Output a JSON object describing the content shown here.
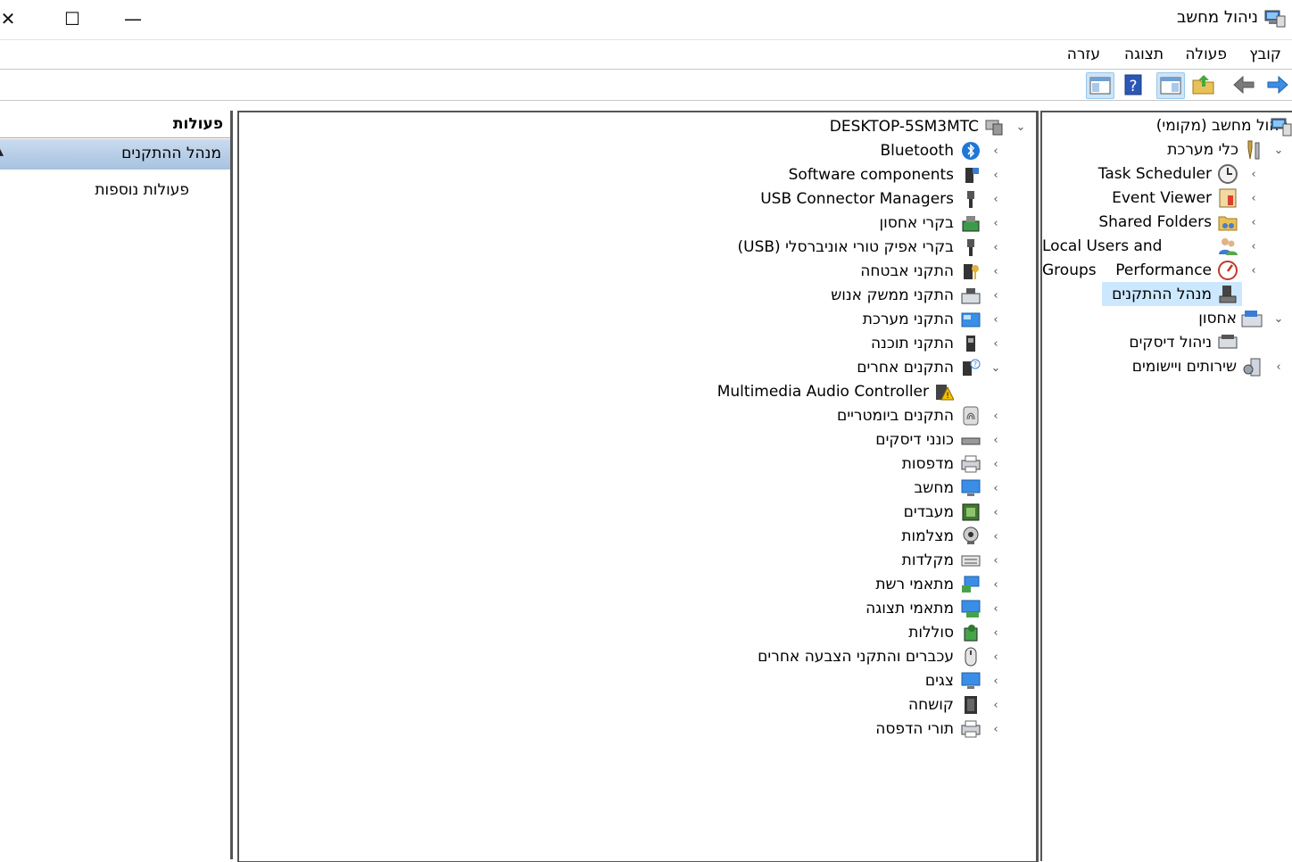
{
  "window": {
    "title": "ניהול מחשב",
    "minimize": "—",
    "maximize": "☐",
    "close": "✕"
  },
  "menu": [
    "קובץ",
    "פעולה",
    "תצוגה",
    "עזרה"
  ],
  "toolbar": {
    "icons": [
      "forward-arrow-icon",
      "back-arrow-icon",
      "up-folder-icon",
      "show-hide-tree-icon",
      "help-icon",
      "show-hide-action-pane-icon"
    ]
  },
  "tree": {
    "root": "ניהול מחשב (מקומי)",
    "system_tools": "כלי מערכת",
    "task_scheduler": "Task Scheduler",
    "event_viewer": "Event Viewer",
    "shared_folders": "Shared Folders",
    "local_users": "Local Users and Groups",
    "performance": "Performance",
    "device_manager": "מנהל ההתקנים",
    "storage": "אחסון",
    "disk_management": "ניהול דיסקים",
    "services": "שירותים ויישומים"
  },
  "devices": {
    "computer": "DESKTOP-5SM3MTC",
    "items": [
      {
        "label": "Bluetooth",
        "icon": "bluetooth-icon"
      },
      {
        "label": "Software components",
        "icon": "software-components-icon"
      },
      {
        "label": "USB Connector Managers",
        "icon": "usb-connector-icon"
      },
      {
        "label": "בקרי אחסון",
        "icon": "storage-controller-icon"
      },
      {
        "label": "בקרי אפיק טורי אוניברסלי (USB)",
        "icon": "usb-controller-icon"
      },
      {
        "label": "התקני אבטחה",
        "icon": "security-device-icon"
      },
      {
        "label": "התקני ממשק אנוש",
        "icon": "hid-icon"
      },
      {
        "label": "התקני מערכת",
        "icon": "system-devices-icon"
      },
      {
        "label": "התקני תוכנה",
        "icon": "software-device-icon"
      },
      {
        "label": "התקנים אחרים",
        "icon": "other-devices-icon",
        "expanded": true
      },
      {
        "label": "Multimedia Audio Controller",
        "icon": "warning-device-icon",
        "child": true
      },
      {
        "label": "התקנים ביומטריים",
        "icon": "biometric-icon"
      },
      {
        "label": "כונני דיסקים",
        "icon": "disk-drive-icon"
      },
      {
        "label": "מדפסות",
        "icon": "printer-icon"
      },
      {
        "label": "מחשב",
        "icon": "computer-icon"
      },
      {
        "label": "מעבדים",
        "icon": "processor-icon"
      },
      {
        "label": "מצלמות",
        "icon": "camera-icon"
      },
      {
        "label": "מקלדות",
        "icon": "keyboard-icon"
      },
      {
        "label": "מתאמי רשת",
        "icon": "network-adapter-icon"
      },
      {
        "label": "מתאמי תצוגה",
        "icon": "display-adapter-icon"
      },
      {
        "label": "סוללות",
        "icon": "battery-icon"
      },
      {
        "label": "עכברים והתקני הצבעה אחרים",
        "icon": "mouse-icon"
      },
      {
        "label": "צגים",
        "icon": "monitor-icon"
      },
      {
        "label": "קושחה",
        "icon": "firmware-icon"
      },
      {
        "label": "תורי הדפסה",
        "icon": "print-queue-icon"
      }
    ]
  },
  "actions": {
    "header": "פעולות",
    "selected": "מנהל ההתקנים",
    "more": "פעולות נוספות"
  },
  "colors": {
    "selection": "#cce8ff",
    "header_band": "#b4cbe3",
    "border": "#555555"
  }
}
